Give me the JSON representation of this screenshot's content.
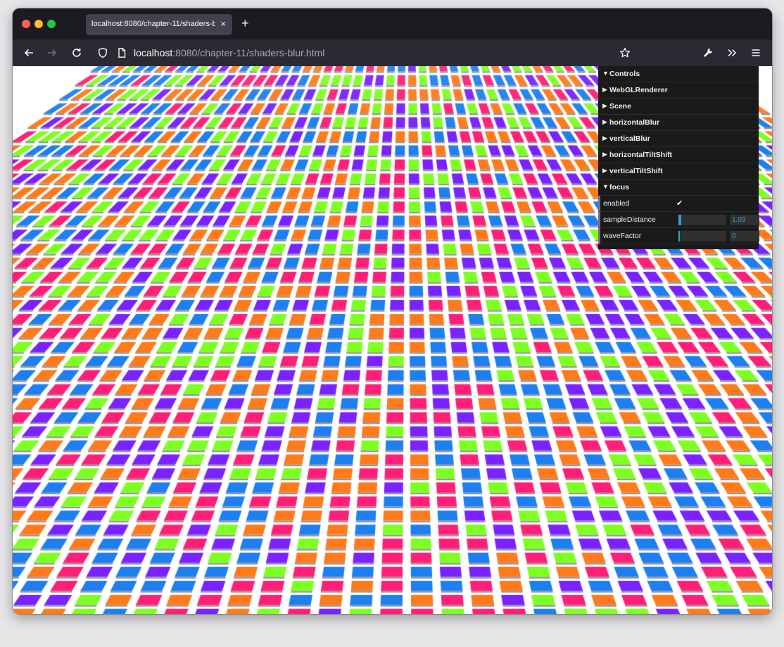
{
  "tab": {
    "title": "localhost:8080/chapter-11/shaders-blur.html",
    "close": "×"
  },
  "newtab": "+",
  "url": {
    "host": "localhost",
    "rest": ":8080/chapter-11/shaders-blur.html"
  },
  "gui": {
    "root": "Controls",
    "folders": [
      "WebGLRenderer",
      "Scene",
      "horizontalBlur",
      "verticalBlur",
      "horizontalTiltShift",
      "verticalTiltShift"
    ],
    "focus": {
      "label": "focus",
      "enabled_label": "enabled",
      "enabled": true,
      "sampleDistance_label": "sampleDistance",
      "sampleDistance": "1.03",
      "sampleDistance_fraction": 0.06,
      "waveFactor_label": "waveFactor",
      "waveFactor": "0",
      "waveFactor_fraction": 0.0
    }
  },
  "colors": {
    "cube_palette": [
      "#ff7a1a",
      "#7cff21",
      "#1e7ff0",
      "#7a22ff",
      "#ff1f78"
    ],
    "gui_accent": "#2fa1d6"
  }
}
